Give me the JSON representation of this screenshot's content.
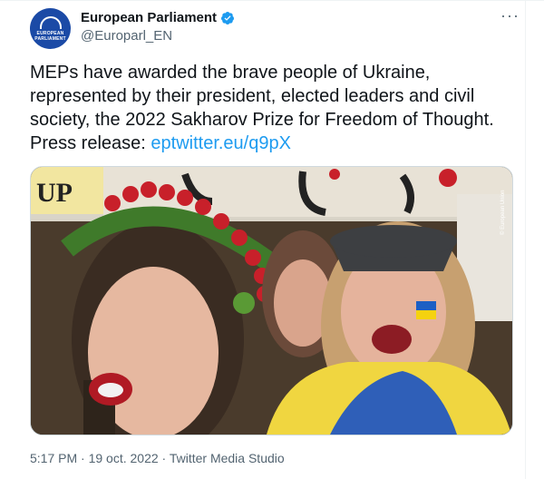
{
  "tweet": {
    "author": {
      "display_name": "European Parliament",
      "handle": "@Europarl_EN",
      "avatar_text": "EUROPEAN PARLIAMENT"
    },
    "text": "MEPs have awarded the brave people of Ukraine, represented by their president, elected leaders and civil society, the 2022 Sakharov Prize for Freedom of Thought. Press release: ",
    "link": "eptwitter.eu/q9pX",
    "more_label": "···",
    "media": {
      "sign_text": "UP",
      "credit": "© European Union"
    },
    "timestamp": "5:17 PM · 19 oct. 2022 · Twitter Media Studio"
  },
  "colors": {
    "accent": "#1d9bf0",
    "secondary_text": "#536471",
    "brand": "#1b4aa6"
  }
}
